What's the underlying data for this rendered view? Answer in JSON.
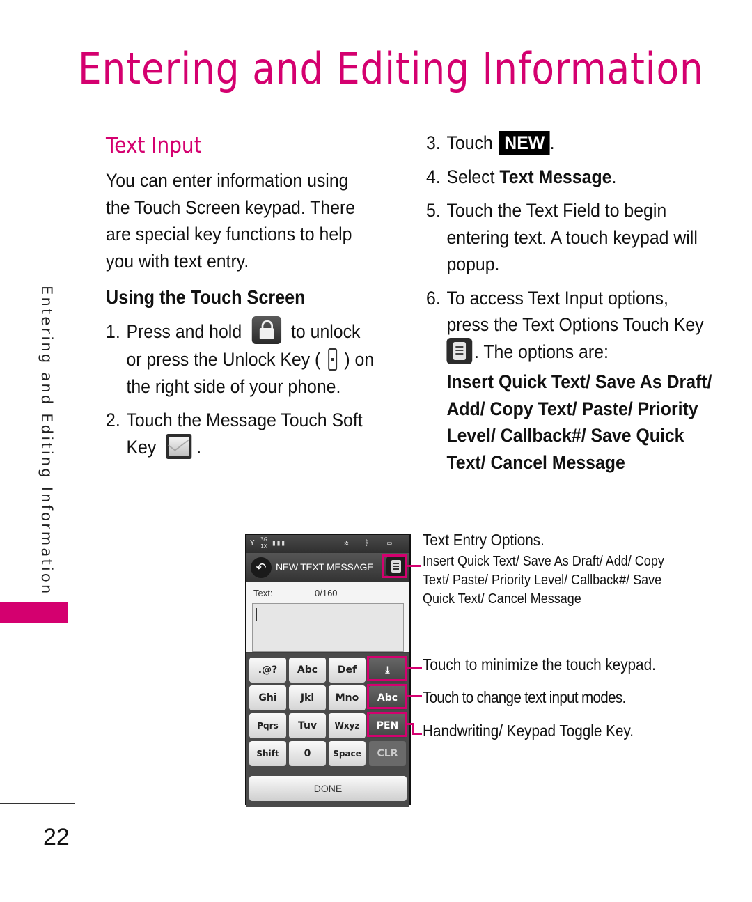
{
  "page": {
    "title": "Entering and Editing Information",
    "side_tab": "Entering and Editing Information",
    "page_number": "22",
    "accent_color": "#d4006f"
  },
  "left": {
    "section_title": "Text Input",
    "intro_lines": [
      "You can enter information using",
      "the Touch Screen keypad. There",
      "are special key functions to help",
      "you with text entry."
    ],
    "subsection_title": "Using the Touch Screen",
    "step1": {
      "num": "1.",
      "line1_pre": "Press and hold",
      "line1_icon": "lock-icon",
      "line1_post": "to unlock",
      "line2_pre": "or press the Unlock Key (",
      "line2_icon": "unlock-key-icon",
      "line2_post": ") on",
      "line3": "the right side of your phone."
    },
    "step2": {
      "num": "2.",
      "line1": "Touch the Message Touch Soft",
      "line2_pre": "Key",
      "line2_icon": "message-icon",
      "line2_post": "."
    }
  },
  "right": {
    "step3": {
      "num": "3.",
      "pre": "Touch",
      "badge": "NEW",
      "post": "."
    },
    "step4": {
      "num": "4.",
      "pre": "Select",
      "bold": "Text Message",
      "post": "."
    },
    "step5": {
      "num": "5.",
      "lines": [
        "Touch the Text Field to begin",
        "entering text. A touch keypad will",
        "popup."
      ]
    },
    "step6": {
      "num": "6.",
      "line1": "To access Text Input options,",
      "line2": "press the Text Options Touch Key",
      "line3_icon": "options-icon",
      "line3_post": ". The options are:",
      "options_lines": [
        "Insert Quick Text/ Save As Draft/",
        "Add/ Copy Text/ Paste/ Priority",
        "Level/ Callback#/ Save Quick",
        "Text/ Cancel Message"
      ]
    }
  },
  "phone": {
    "status": {
      "network": "3G",
      "network2": "1X"
    },
    "title": "NEW TEXT MESSAGE",
    "text_label": "Text:",
    "text_count": "0/160",
    "keys": [
      [
        ".@?",
        "Abc",
        "Def",
        "⤓"
      ],
      [
        "Ghi",
        "Jkl",
        "Mno",
        "Abc"
      ],
      [
        "Pqrs",
        "Tuv",
        "Wxyz",
        "PEN"
      ],
      [
        "Shift",
        "0",
        "Space",
        "CLR"
      ]
    ],
    "done": "DONE"
  },
  "callouts": {
    "options_title": "Text Entry Options.",
    "options_lines": [
      "Insert Quick Text/ Save As Draft/ Add/ Copy",
      "Text/ Paste/ Priority Level/ Callback#/ Save",
      "Quick Text/ Cancel Message"
    ],
    "minimize": "Touch to minimize the touch keypad.",
    "mode": "Touch to change text input modes.",
    "pen": "Handwriting/ Keypad Toggle Key."
  }
}
